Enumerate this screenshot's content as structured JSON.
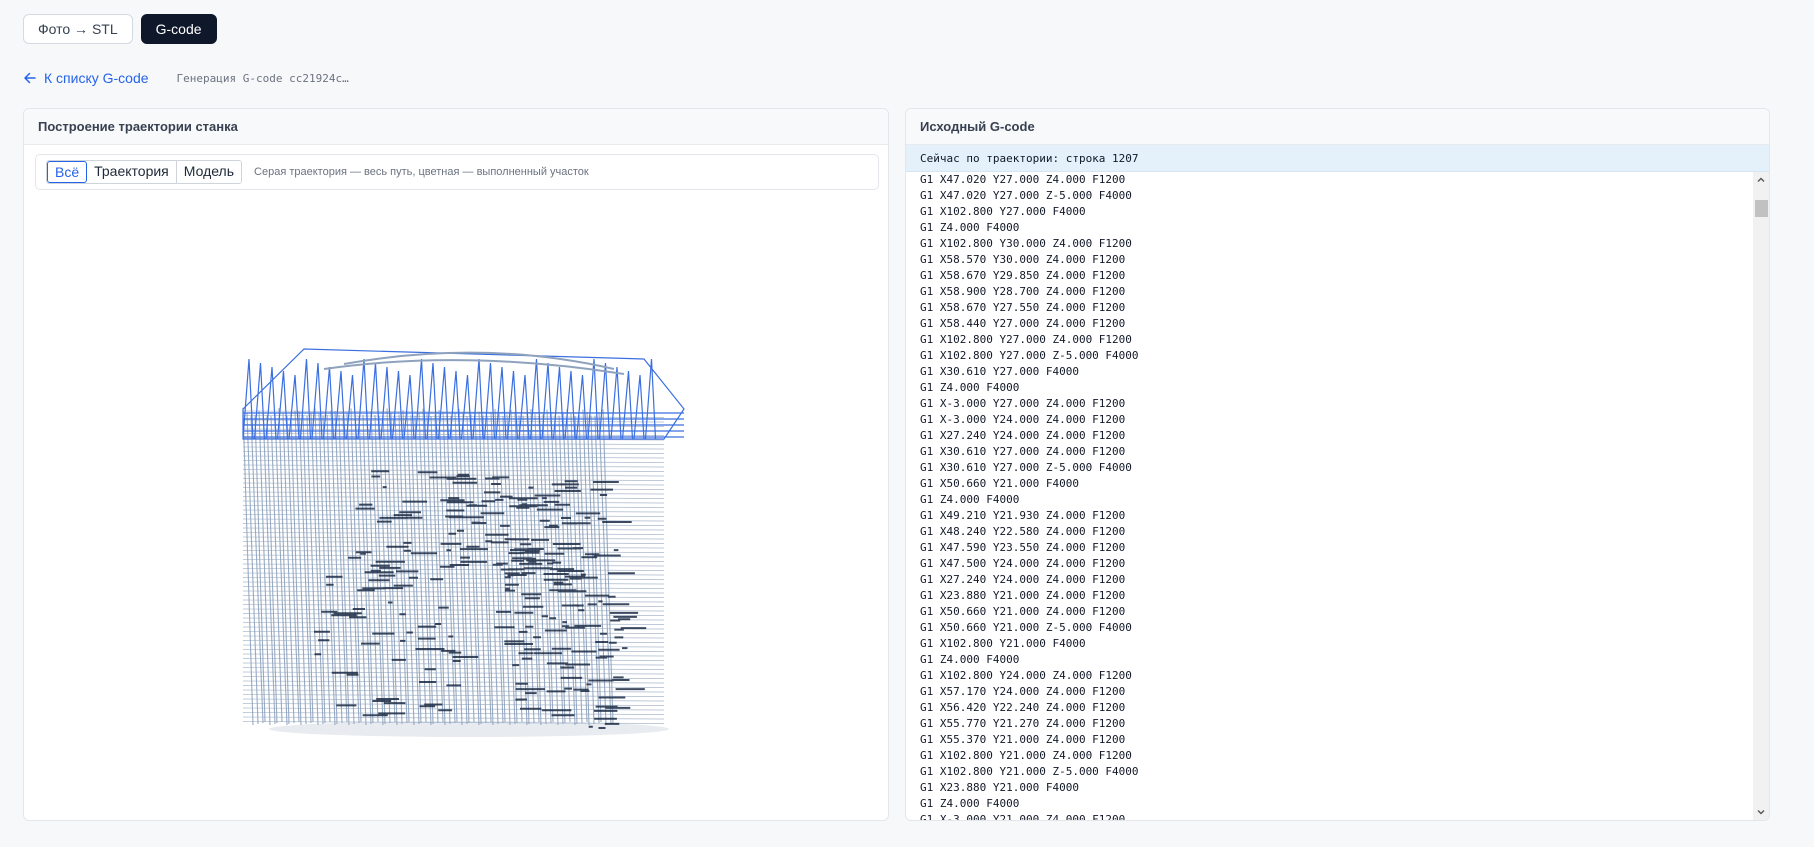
{
  "top_tabs": [
    {
      "label": "Фото → STL",
      "active": false
    },
    {
      "label": "G-code",
      "active": true
    }
  ],
  "back_link": {
    "label": "К списку G-code",
    "icon": "arrow-left-icon"
  },
  "job_label": "Генерация G-code cc21924c…",
  "left_panel": {
    "title": "Построение траектории станка",
    "view_modes": [
      "Всё",
      "Траектория",
      "Модель"
    ],
    "active_view_mode": "Всё",
    "hint": "Серая траектория — весь путь, цветная — выполненный участок"
  },
  "right_panel": {
    "title": "Исходный G-code",
    "current_line_text": "Сейчас по траектории: строка 1207",
    "code_lines": [
      "G1 X47.020 Y27.000 Z4.000 F1200",
      "G1 X47.020 Y27.000 Z-5.000 F4000",
      "G1 X102.800 Y27.000 F4000",
      "G1 Z4.000 F4000",
      "G1 X102.800 Y30.000 Z4.000 F1200",
      "G1 X58.570 Y30.000 Z4.000 F1200",
      "G1 X58.670 Y29.850 Z4.000 F1200",
      "G1 X58.900 Y28.700 Z4.000 F1200",
      "G1 X58.670 Y27.550 Z4.000 F1200",
      "G1 X58.440 Y27.000 Z4.000 F1200",
      "G1 X102.800 Y27.000 Z4.000 F1200",
      "G1 X102.800 Y27.000 Z-5.000 F4000",
      "G1 X30.610 Y27.000 F4000",
      "G1 Z4.000 F4000",
      "G1 X-3.000 Y27.000 Z4.000 F1200",
      "G1 X-3.000 Y24.000 Z4.000 F1200",
      "G1 X27.240 Y24.000 Z4.000 F1200",
      "G1 X30.610 Y27.000 Z4.000 F1200",
      "G1 X30.610 Y27.000 Z-5.000 F4000",
      "G1 X50.660 Y21.000 F4000",
      "G1 Z4.000 F4000",
      "G1 X49.210 Y21.930 Z4.000 F1200",
      "G1 X48.240 Y22.580 Z4.000 F1200",
      "G1 X47.590 Y23.550 Z4.000 F1200",
      "G1 X47.500 Y24.000 Z4.000 F1200",
      "G1 X27.240 Y24.000 Z4.000 F1200",
      "G1 X23.880 Y21.000 Z4.000 F1200",
      "G1 X50.660 Y21.000 Z4.000 F1200",
      "G1 X50.660 Y21.000 Z-5.000 F4000",
      "G1 X102.800 Y21.000 F4000",
      "G1 Z4.000 F4000",
      "G1 X102.800 Y24.000 Z4.000 F1200",
      "G1 X57.170 Y24.000 Z4.000 F1200",
      "G1 X56.420 Y22.240 Z4.000 F1200",
      "G1 X55.770 Y21.270 Z4.000 F1200",
      "G1 X55.370 Y21.000 Z4.000 F1200",
      "G1 X102.800 Y21.000 Z4.000 F1200",
      "G1 X102.800 Y21.000 Z-5.000 F4000",
      "G1 X23.880 Y21.000 F4000",
      "G1 Z4.000 F4000",
      "G1 X-3.000 Y21.000 Z4.000 F1200"
    ]
  },
  "colors": {
    "accent": "#2563eb",
    "dark_tab": "#0f172a",
    "path_gray": "#8ea2bd",
    "path_done": "#3b6fe0",
    "model_dark": "#1b2a44",
    "current_line_bg": "#e4f1fb"
  }
}
